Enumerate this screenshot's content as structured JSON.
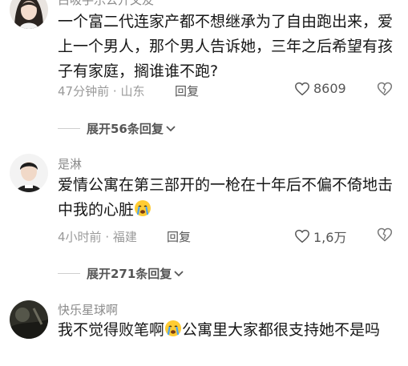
{
  "comments": [
    {
      "author": "白吸手乐公开文友",
      "text": "一个富二代连家产都不想继承为了自由跑出来，爱上一个男人，那个男人告诉她，三年之后希望有孩子有家庭，搁谁谁不跑?",
      "time": "47分钟前",
      "location": "山东",
      "reply_label": "回复",
      "likes": "8609",
      "expand_label": "展开56条回复"
    },
    {
      "author": "是淋",
      "text_before_emoji": "爱情公寓在第三部开的一枪在十年后不偏不倚地击中我的心脏",
      "emoji": "crying-face",
      "time": "4小时前",
      "location": "福建",
      "reply_label": "回复",
      "likes": "1,6万",
      "expand_label": "展开271条回复"
    },
    {
      "author": "快乐星球啊",
      "text_before_emoji": "我不觉得败笔啊",
      "emoji": "crying-face",
      "text_after_emoji": "公寓里大家都很支持她不是吗"
    }
  ],
  "meta_separator": "·",
  "icons": {
    "like": "heart-outline-icon",
    "dislike": "broken-heart-icon",
    "expand": "chevron-down-icon"
  }
}
